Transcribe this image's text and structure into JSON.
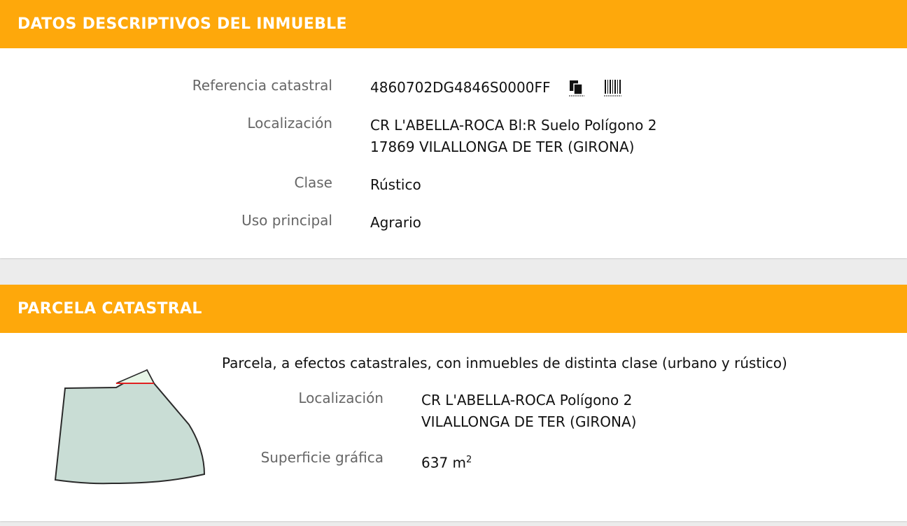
{
  "descriptivos": {
    "header": "DATOS DESCRIPTIVOS DEL INMUEBLE",
    "ref_label": "Referencia catastral",
    "ref_value": "4860702DG4846S0000FF",
    "loc_label": "Localización",
    "loc_line1": "CR L'ABELLA-ROCA Bl:R Suelo Polígono 2",
    "loc_line2": "17869 VILALLONGA DE TER (GIRONA)",
    "clase_label": "Clase",
    "clase_value": "Rústico",
    "uso_label": "Uso principal",
    "uso_value": "Agrario",
    "icons": [
      "copy-icon",
      "barcode-icon"
    ]
  },
  "parcela": {
    "header": "PARCELA CATASTRAL",
    "description": "Parcela, a efectos catastrales, con inmuebles de distinta clase (urbano y rústico)",
    "loc_label": "Localización",
    "loc_line1": "CR L'ABELLA-ROCA Polígono 2",
    "loc_line2": "VILALLONGA DE TER (GIRONA)",
    "sup_label": "Superficie gráfica",
    "sup_value": "637 m",
    "sup_unit_exp": "2"
  },
  "colors": {
    "header_bg": "#fea80b",
    "parcel_fill": "#c9ddd5",
    "parcel_highlight": "#e6f5e6",
    "parcel_edge_red": "#e02020"
  }
}
